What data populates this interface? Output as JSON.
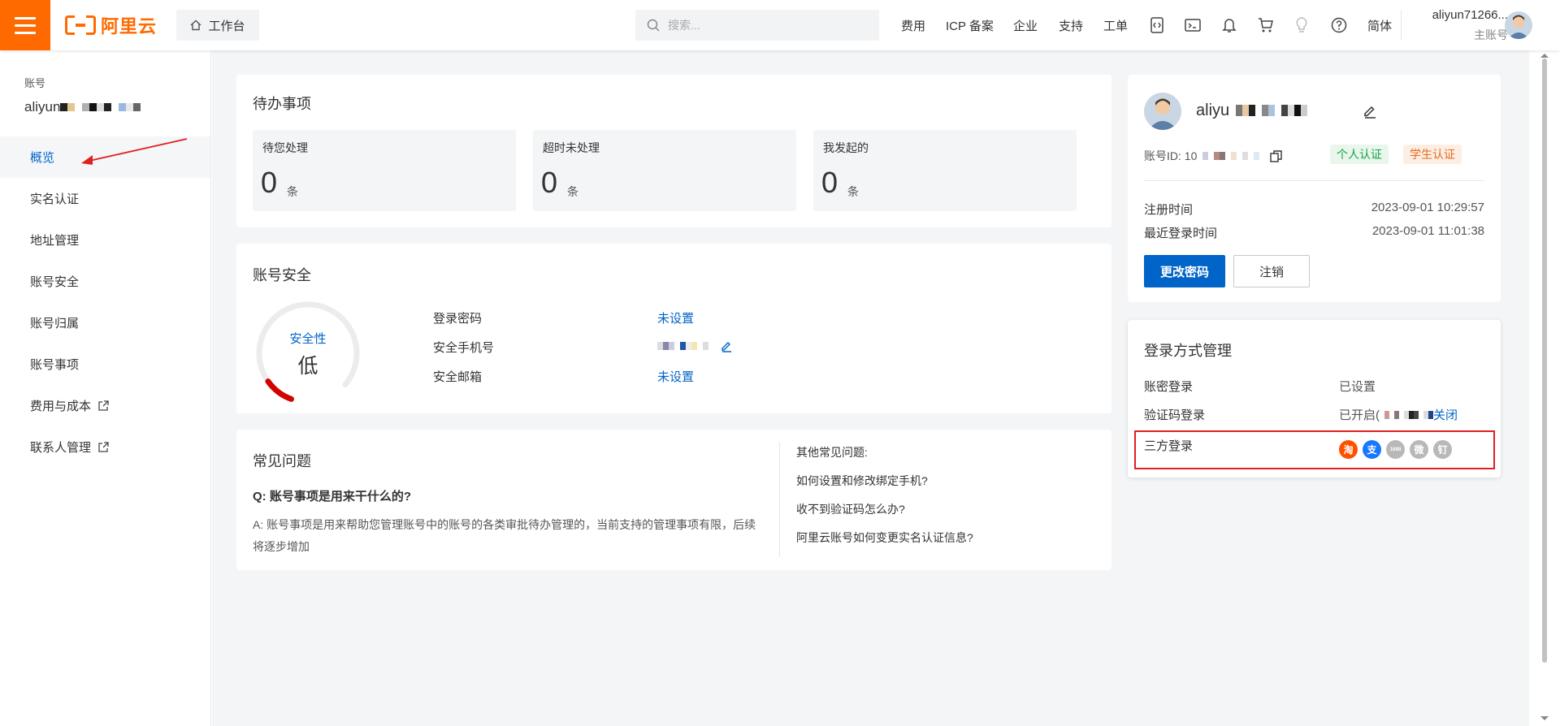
{
  "topbar": {
    "logo_text": "阿里云",
    "workbench_label": "工作台",
    "search_placeholder": "搜索...",
    "nav": [
      "费用",
      "ICP 备案",
      "企业",
      "支持",
      "工单"
    ],
    "lang": "简体",
    "user_name": "aliyun71266...",
    "user_role": "主账号",
    "icons": [
      "code-icon",
      "terminal-icon",
      "bell-icon",
      "cart-icon",
      "lightbulb-icon",
      "help-icon"
    ]
  },
  "sidebar": {
    "label": "账号",
    "account_prefix": "aliyun",
    "items": [
      {
        "label": "概览",
        "active": true,
        "external": false
      },
      {
        "label": "实名认证",
        "active": false,
        "external": false
      },
      {
        "label": "地址管理",
        "active": false,
        "external": false
      },
      {
        "label": "账号安全",
        "active": false,
        "external": false
      },
      {
        "label": "账号归属",
        "active": false,
        "external": false
      },
      {
        "label": "账号事项",
        "active": false,
        "external": false
      },
      {
        "label": "费用与成本",
        "active": false,
        "external": true
      },
      {
        "label": "联系人管理",
        "active": false,
        "external": true
      }
    ]
  },
  "todo": {
    "title": "待办事项",
    "boxes": [
      {
        "label": "待您处理",
        "value": "0",
        "unit": "条"
      },
      {
        "label": "超时未处理",
        "value": "0",
        "unit": "条"
      },
      {
        "label": "我发起的",
        "value": "0",
        "unit": "条"
      }
    ]
  },
  "security": {
    "title": "账号安全",
    "gauge_label": "安全性",
    "gauge_level": "低",
    "gauge_fraction": 0.12,
    "rows": [
      {
        "label": "登录密码",
        "value": "未设置"
      },
      {
        "label": "安全手机号",
        "value": ""
      },
      {
        "label": "安全邮箱",
        "value": "未设置"
      }
    ]
  },
  "faq": {
    "title": "常见问题",
    "question": "Q:  账号事项是用来干什么的?",
    "answer": "A:  账号事项是用来帮助您管理账号中的账号的各类审批待办管理的，当前支持的管理事项有限，后续将逐步增加",
    "other_title": "其他常见问题:",
    "other": [
      "如何设置和修改绑定手机?",
      "收不到验证码怎么办?",
      "阿里云账号如何变更实名认证信息?"
    ]
  },
  "profile": {
    "name_prefix": "aliyu",
    "id_label": "账号ID: 10",
    "badge_personal": "个人认证",
    "badge_student": "学生认证",
    "reg_label": "注册时间",
    "reg_value": "2023-09-01 10:29:57",
    "last_label": "最近登录时间",
    "last_value": "2023-09-01 11:01:38",
    "change_pwd": "更改密码",
    "logout": "注销"
  },
  "login_mgmt": {
    "title": "登录方式管理",
    "rows": [
      {
        "label": "账密登录",
        "value": "已设置"
      },
      {
        "label": "验证码登录",
        "value": "已开启(",
        "action": "关闭"
      },
      {
        "label": "三方登录"
      }
    ],
    "third_party": [
      {
        "name": "taobao",
        "glyph": "淘",
        "color": "#ff5000"
      },
      {
        "name": "alipay",
        "glyph": "支",
        "color": "#1677ff"
      },
      {
        "name": "1688",
        "glyph": "1688",
        "color": "#b8b8b8"
      },
      {
        "name": "weibo",
        "glyph": "微",
        "color": "#b8b8b8"
      },
      {
        "name": "dingtalk",
        "glyph": "钉",
        "color": "#b8b8b8"
      }
    ]
  },
  "colors": {
    "accent": "#ff6a00",
    "primary": "#0064c8",
    "danger": "#e02020"
  }
}
